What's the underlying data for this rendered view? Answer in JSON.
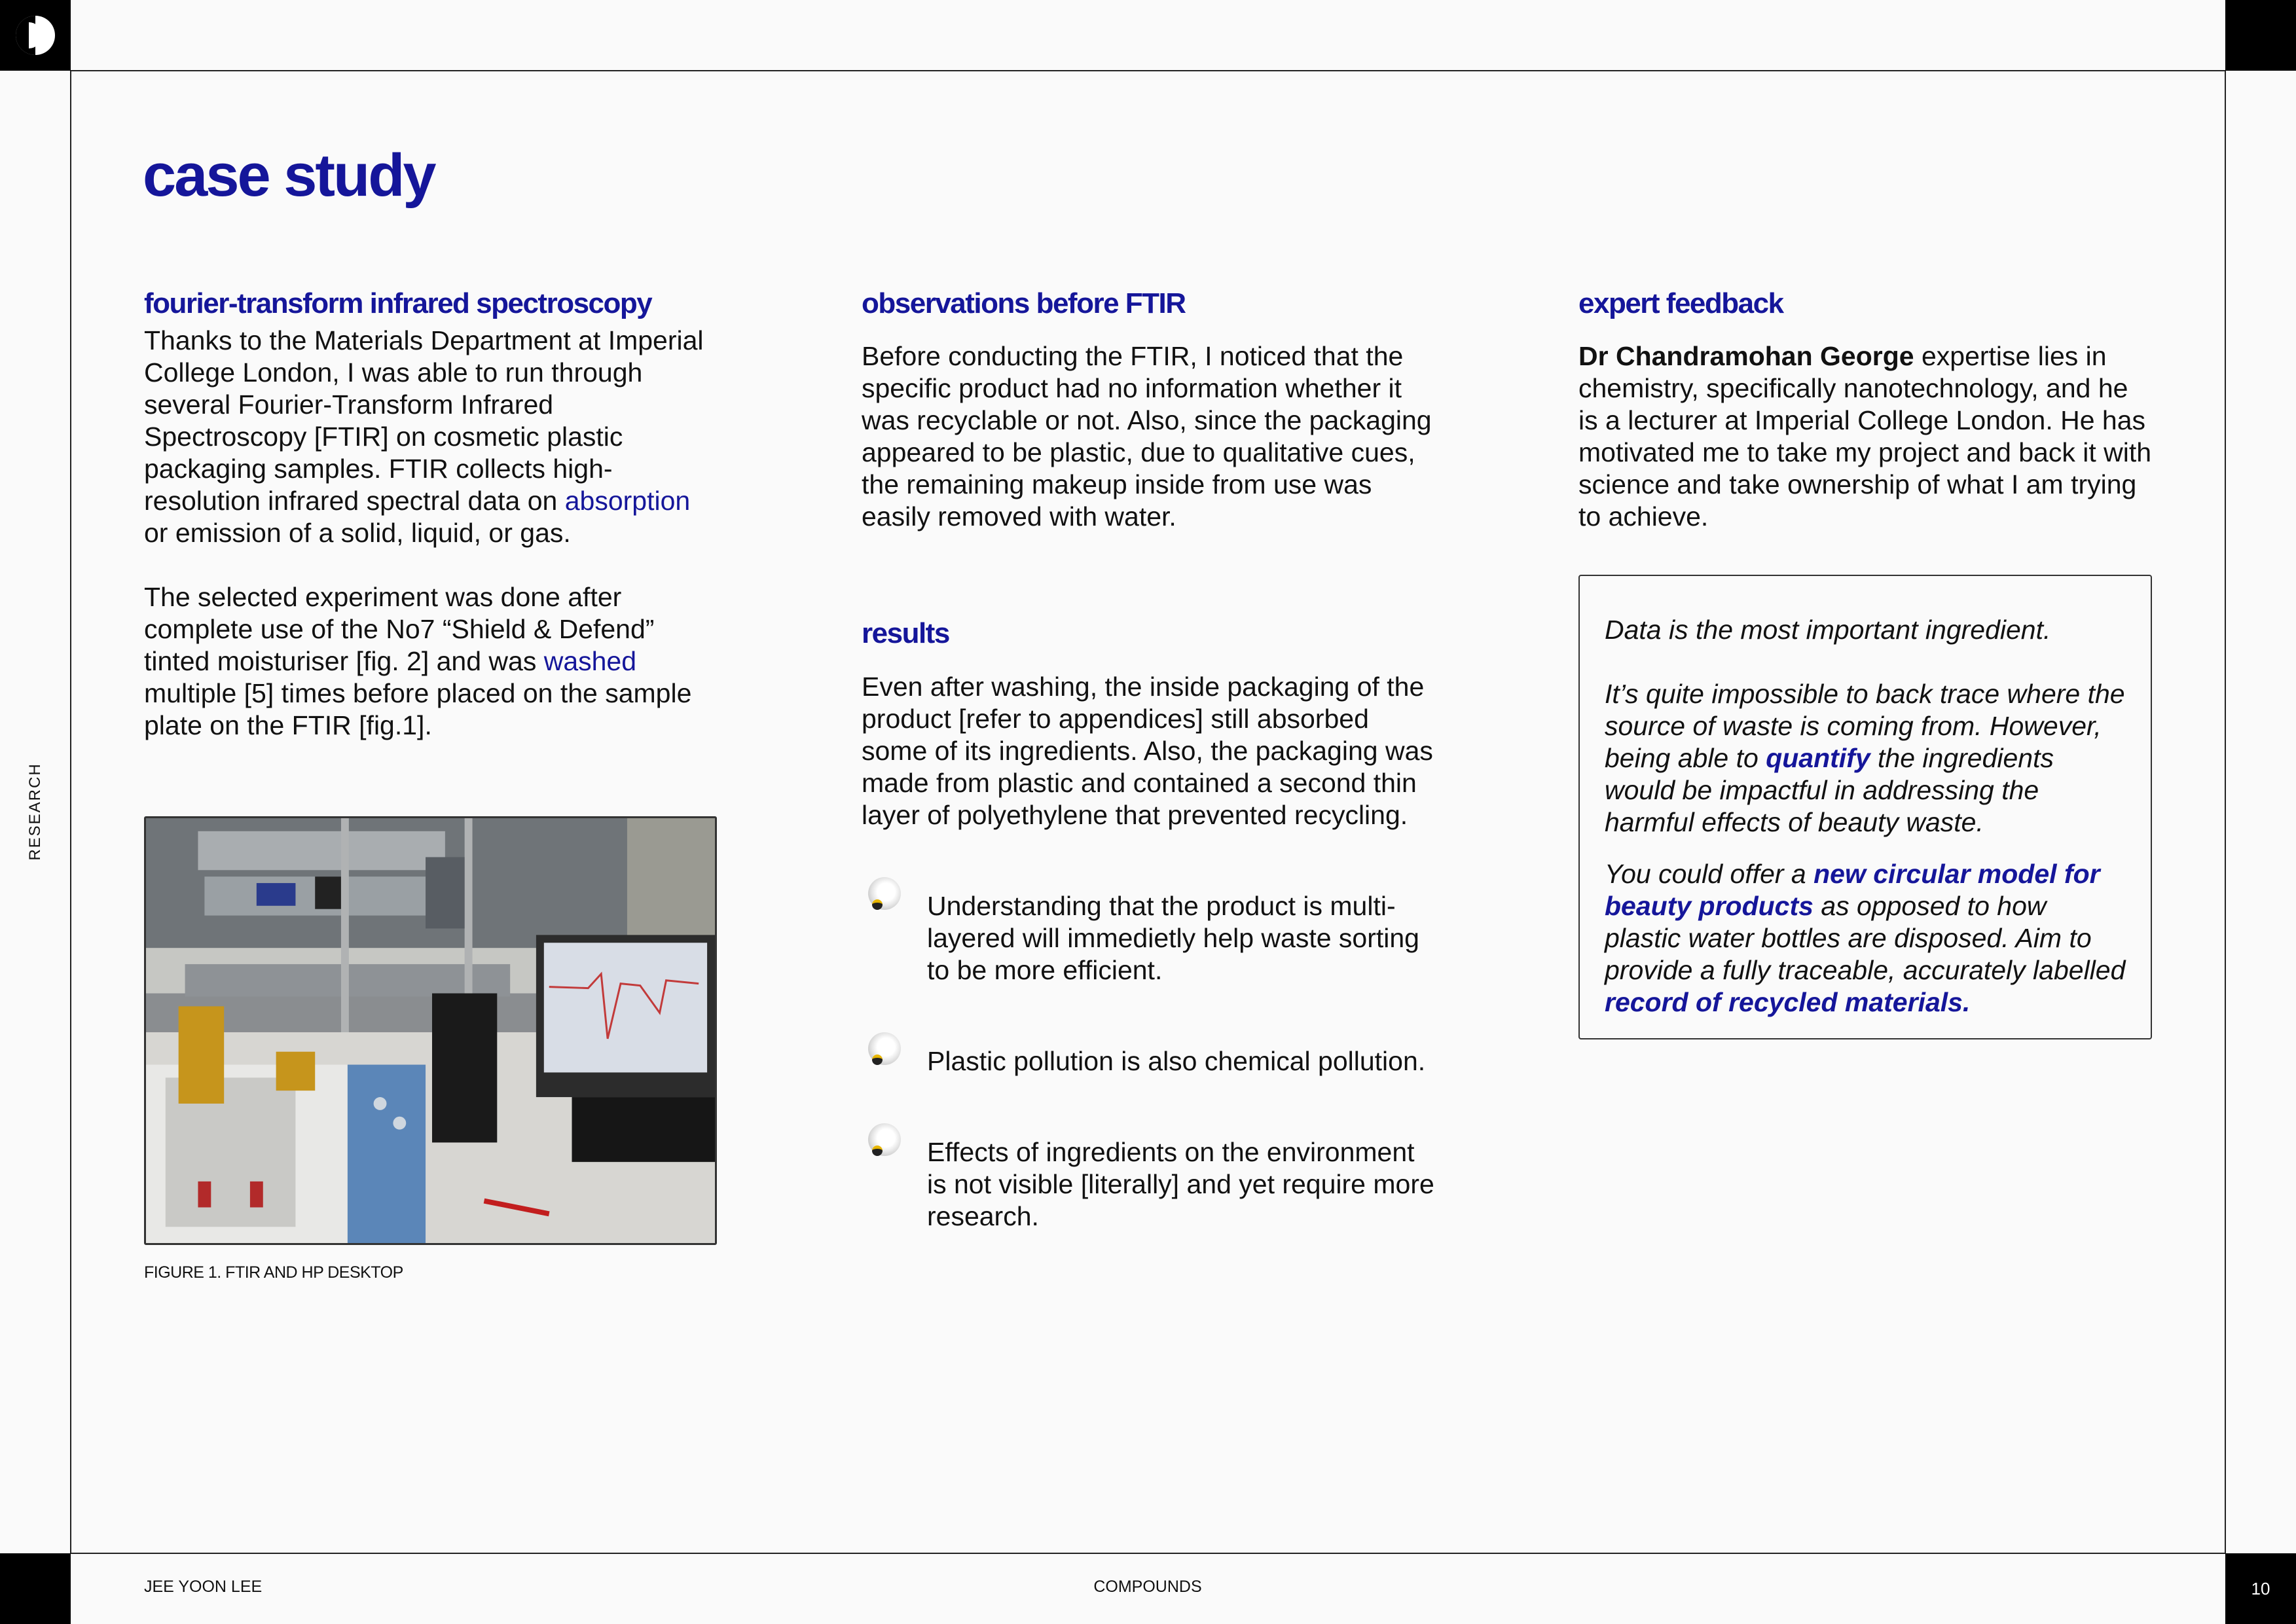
{
  "frame": {
    "side_label": "RESEARCH",
    "page_number": "10",
    "footer_left": "JEE YOON LEE",
    "footer_center": "COMPOUNDS"
  },
  "title": "case study",
  "col1": {
    "heading": "fourier-transform infrared spectroscopy",
    "p1_a": "Thanks to the Materials Department at Imperial College London, I was able to run through several Fourier-Transform Infrared Spectroscopy [FTIR] on cosmetic plastic packaging samples. FTIR collects high-resolution infrared spectral data on ",
    "p1_link": "absorption",
    "p1_b": " or emission of a solid, liquid, or gas.",
    "p2_a": "The selected experiment was done after complete use of the No7 “Shield & Defend” tinted moisturiser [fig. 2] and was ",
    "p2_link": "washed",
    "p2_b": " multiple [5] times before placed on the sample plate on the FTIR [fig.1].",
    "caption": "FIGURE 1. FTIR AND HP DESKTOP"
  },
  "col2": {
    "heading1": "observations before FTIR",
    "p1": "Before conducting the FTIR, I noticed that the specific product had no information whether it was recyclable or not. Also, since the packaging appeared to be plastic, due to qualitative cues, the remaining makeup inside from use was easily removed with water.",
    "heading2": "results",
    "p2": "Even after washing, the inside packaging of the product [refer to appendices] still absorbed some of its ingredients. Also, the packaging was made from plastic and contained a second thin layer of polyethylene that prevented recycling.",
    "bullets": [
      "Understanding that the product is multi-layered will immedietly help waste sorting to be more efficient.",
      "Plastic pollution is also chemical pollution.",
      "Effects of ingredients on the environment is not visible [literally] and yet require more research."
    ]
  },
  "col3": {
    "heading": "expert feedback",
    "p1_name": "Dr Chandramohan George",
    "p1_rest": " expertise lies in chemistry, specifically nanotechnology, and he is a lecturer at Imperial College London. He has motivated me to take my project and back it with science and take ownership of what I am trying to achieve.",
    "quote": {
      "q1": "Data is the most important ingredient.",
      "q2_a": "It’s quite impossible to back trace where the source of waste is coming from. However, being able to ",
      "q2_link": "quantify",
      "q2_b": " the ingredients would be impactful in addressing the harmful effects of beauty waste.",
      "q3_a": "You could offer a ",
      "q3_link1": "new circular model for beauty products",
      "q3_b": " as opposed to how plastic water bottles are disposed. Aim to provide a fully traceable, accurately labelled ",
      "q3_link2": "record of recycled materials."
    }
  },
  "colors": {
    "accent": "#15169a",
    "frame": "#000000",
    "background": "#fafafa"
  }
}
